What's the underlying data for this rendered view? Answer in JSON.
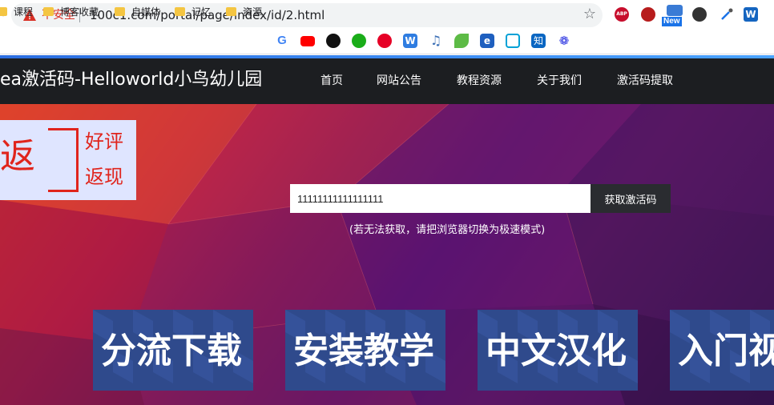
{
  "browser": {
    "security_label": "不安全",
    "url": "100c1.com/portal/page/index/id/2.html",
    "left_edge_glyph": "↻",
    "extensions": {
      "abp_label": "ABP",
      "new_label": "New",
      "w_label": "W"
    }
  },
  "bookmarks": {
    "items": [
      {
        "label": "课程",
        "kind": "folder"
      },
      {
        "label": "博客收藏",
        "kind": "folder"
      },
      {
        "label": "自媒体",
        "kind": "folder"
      },
      {
        "label": "记忆",
        "kind": "folder"
      },
      {
        "label": "资源",
        "kind": "folder"
      }
    ],
    "icon_sites": [
      "google-icon",
      "youtube-icon",
      "github-icon",
      "wechat-icon",
      "netease-music-icon",
      "w-app-icon",
      "music-note-icon",
      "leaf-icon",
      "edge-icon",
      "bilibili-icon",
      "zhihu-icon",
      "baidu-paw-icon"
    ],
    "icon_glyphs": {
      "google": "G",
      "w_app": "W",
      "music_note": "♫",
      "edge": "e",
      "zhihu": "知",
      "baidu_paw": "❁"
    }
  },
  "site": {
    "title": "ea激活码-Helloworld小鸟幼儿园",
    "nav": [
      {
        "label": "首页"
      },
      {
        "label": "网站公告"
      },
      {
        "label": "教程资源"
      },
      {
        "label": "关于我们"
      },
      {
        "label": "激活码提取"
      }
    ]
  },
  "hero": {
    "badge": {
      "big_char": "返",
      "line1": "好评",
      "line2": "返现"
    },
    "code_input_value": "11111111111111111",
    "submit_label": "获取激活码",
    "hint": "(若无法获取，请把浏览器切换为极速模式)",
    "tiles": [
      {
        "label": "分流下载"
      },
      {
        "label": "安装教学"
      },
      {
        "label": "中文汉化"
      },
      {
        "label": "入门视"
      }
    ]
  },
  "colors": {
    "nav_bg": "#1c1e21",
    "accent": "#2b6de0",
    "insecure_red": "#d93025",
    "badge_red": "#e0241c",
    "tile_blue": "#2f4a8c"
  }
}
